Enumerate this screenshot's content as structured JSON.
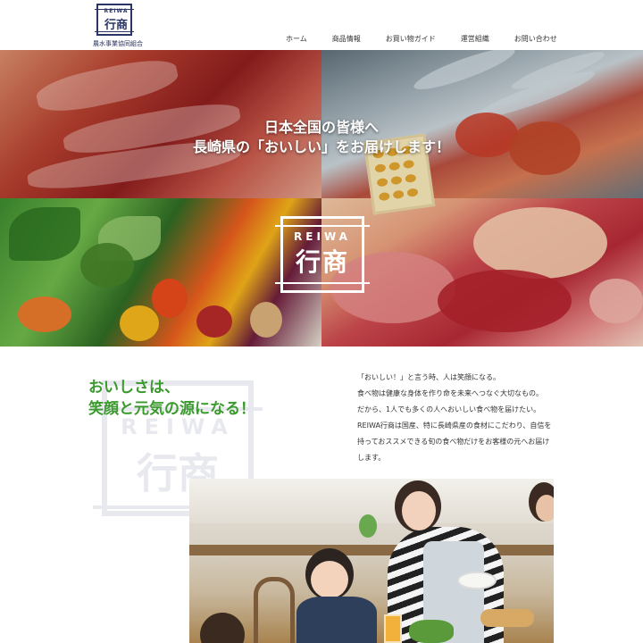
{
  "header": {
    "logo_en": "REIWA",
    "logo_jp": "行商",
    "logo_sub": "農水事業協同組合",
    "nav": [
      {
        "label": "ホーム"
      },
      {
        "label": "商品情報"
      },
      {
        "label": "お買い物ガイド"
      },
      {
        "label": "運営組織"
      },
      {
        "label": "お問い合わせ"
      }
    ]
  },
  "hero": {
    "catch_line1": "日本全国の皆様へ",
    "catch_line2": "長崎県の「おいしい」をお届けします！",
    "logo_en": "REIWA",
    "logo_jp": "行商"
  },
  "intro": {
    "heading_line1": "おいしさは、",
    "heading_line2": "笑顔と元気の源になる！",
    "watermark_en": "REIWA",
    "watermark_jp": "行商",
    "body": [
      "「おいしい！」と言う時、人は笑顔になる。",
      "食べ物は健康な身体を作り命を未来へつなぐ大切なもの。",
      "だから、1人でも多くの人へおいしい食べ物を届けたい。",
      "REIWA行商は国産、特に長崎県産の食材にこだわり、自信を",
      "持っておススメできる旬の食べ物だけをお客様の元へお届け",
      "します。"
    ]
  },
  "colors": {
    "brand_navy": "#2a3566",
    "heading_green": "#3b9a2e"
  }
}
